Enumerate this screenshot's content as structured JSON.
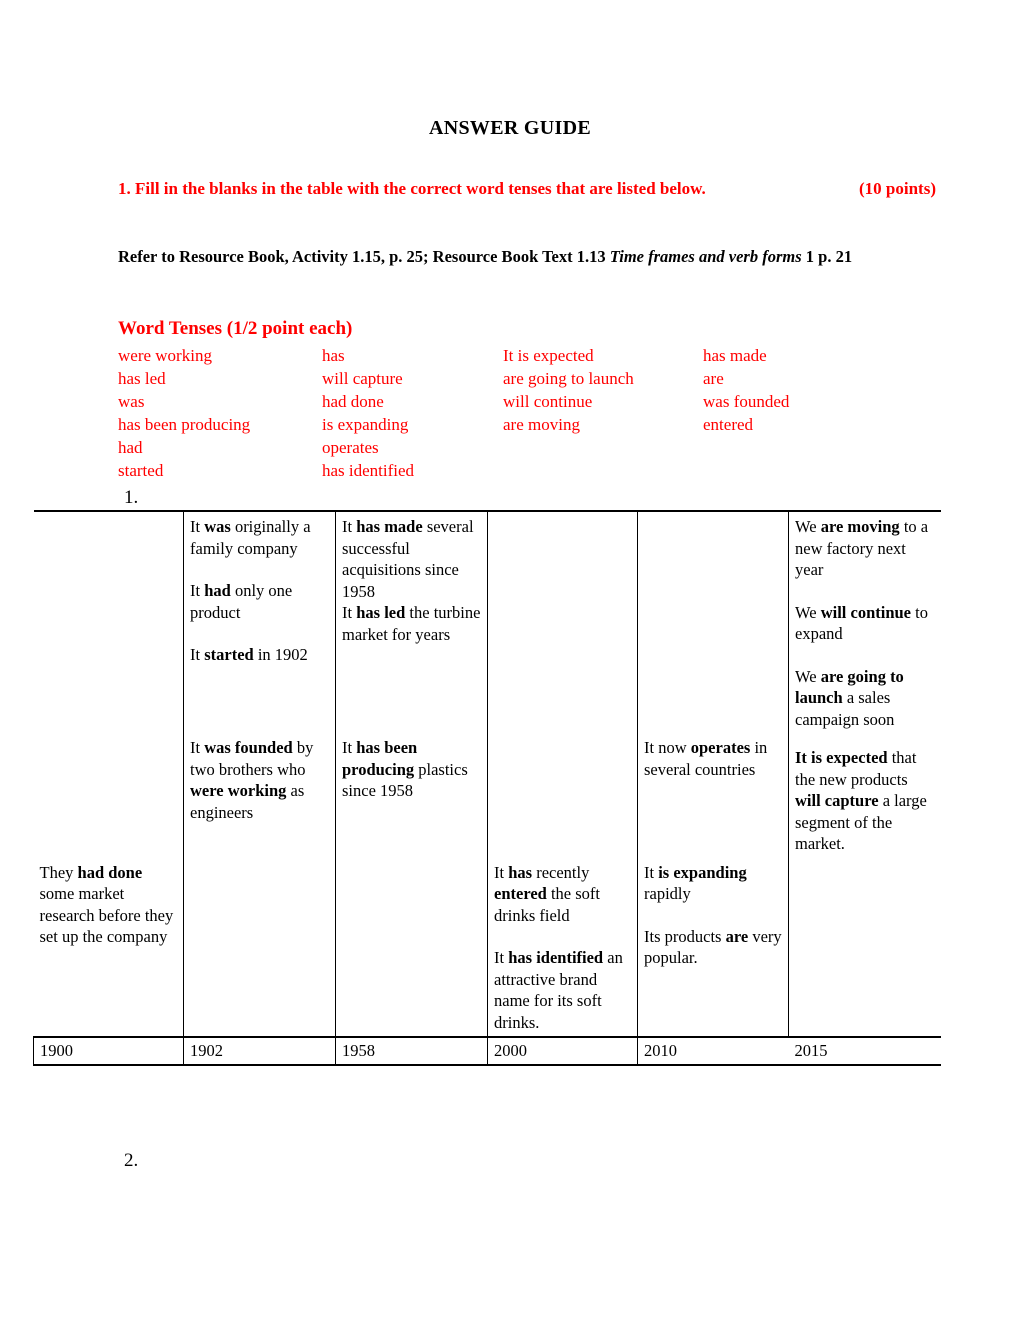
{
  "document": {
    "title": "ANSWER GUIDE",
    "accent_color": "#FF0000",
    "text_color": "#000000"
  },
  "instruction": {
    "main": "1.  Fill in the blanks in the table with the correct word tenses that are listed below.",
    "points": "(10 points)",
    "refer_prefix": "Refer to Resource Book, Activity 1.15, p. 25; Resource Book Text 1.13 ",
    "refer_italic": "Time frames and verb forms",
    "refer_suffix": " 1 p. 21"
  },
  "word_tenses": {
    "heading": "Word Tenses (1/2 point each)",
    "columns": [
      [
        "were working",
        "has led",
        "was",
        "has been producing",
        "had",
        "started"
      ],
      [
        "has",
        "will capture",
        "had done",
        "is expanding",
        "operates",
        "has identified"
      ],
      [
        "It is expected",
        "are going to launch",
        "will continue",
        "are moving"
      ],
      [
        "has made",
        "are",
        "was founded",
        "entered"
      ]
    ]
  },
  "markers": {
    "item_1": "1.",
    "item_2": "2."
  },
  "table": {
    "years": [
      "1900",
      "1902",
      "1958",
      "2000",
      "2010",
      "2015"
    ],
    "row1": {
      "c1": "",
      "c2": [
        {
          "pre": "It ",
          "bold": "was",
          "post": " originally a family company"
        },
        {
          "pre": "It ",
          "bold": "had",
          "post": " only one product"
        },
        {
          "pre": "It ",
          "bold": "started",
          "post": " in 1902"
        }
      ],
      "c3": [
        {
          "pre": "It ",
          "bold": "has made",
          "post": " several successful acquisitions since 1958"
        },
        {
          "pre": "It ",
          "bold": "has led",
          "post": " the turbine market for years"
        }
      ],
      "c4": "",
      "c5": "",
      "c6": [
        {
          "pre": "We ",
          "bold": "are moving",
          "post": " to a new factory next year"
        },
        {
          "pre": "We ",
          "bold": "will continue",
          "post": " to expand"
        },
        {
          "pre": "We ",
          "bold": "are going to launch",
          "post": " a sales campaign soon"
        }
      ]
    },
    "row2": {
      "c1": "",
      "c2": [
        {
          "pre": "It ",
          "bold": "was founded",
          "post": " by two brothers who ",
          "bold2": "were working",
          "post2": " as engineers"
        }
      ],
      "c3": [
        {
          "pre": "It ",
          "bold": "has been producing",
          "post": " plastics since 1958"
        }
      ],
      "c4": "",
      "c5": [
        {
          "pre": "It now ",
          "bold": "operates",
          "post": " in several countries"
        }
      ],
      "c6": [
        {
          "pre": "",
          "bold": "It is expected",
          "post": " that the new products ",
          "bold2": "will capture",
          "post2": " a large segment of the market."
        }
      ]
    },
    "row3": {
      "c1": [
        {
          "pre": "They ",
          "bold": "had done",
          "post": " some market research before they set up the company"
        }
      ],
      "c2": "",
      "c3": "",
      "c4": [
        {
          "pre": "It ",
          "bold": "has",
          "post": " recently ",
          "bold2": "entered",
          "post2": " the soft drinks field"
        },
        {
          "pre": "It ",
          "bold": "has identified",
          "post": " an attractive brand name for its soft drinks."
        }
      ],
      "c5": [
        {
          "pre": "It ",
          "bold": "is expanding",
          "post": " rapidly"
        },
        {
          "pre": "Its products ",
          "bold": "are",
          "post": " very popular."
        }
      ],
      "c6": ""
    }
  }
}
